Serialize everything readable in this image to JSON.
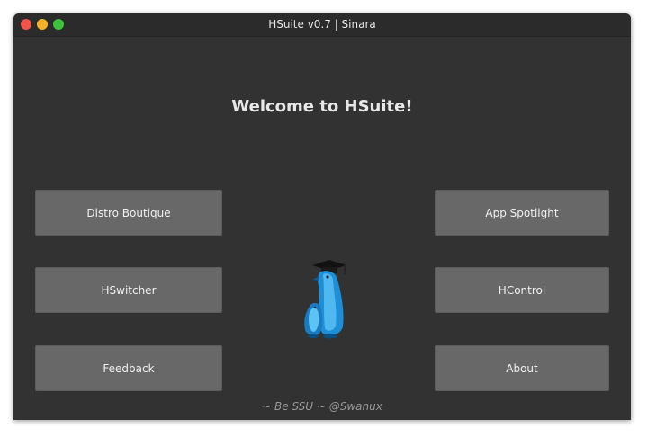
{
  "window": {
    "title": "HSuite v0.7 | Sinara"
  },
  "main": {
    "welcome": "Welcome to HSuite!",
    "footer": "~ Be SSU ~ @Swanux"
  },
  "buttons": {
    "distro_boutique": "Distro Boutique",
    "app_spotlight": "App Spotlight",
    "hswitcher": "HSwitcher",
    "hcontrol": "HControl",
    "feedback": "Feedback",
    "about": "About"
  },
  "icons": {
    "mascot": "penguin-graduate-icon",
    "close": "close-traffic-light-icon",
    "minimize": "minimize-traffic-light-icon",
    "maximize": "maximize-traffic-light-icon"
  },
  "colors": {
    "window_bg": "#323232",
    "button_bg": "#686868",
    "close": "#f0554b",
    "minimize": "#f5b228",
    "maximize": "#3ec13c"
  }
}
